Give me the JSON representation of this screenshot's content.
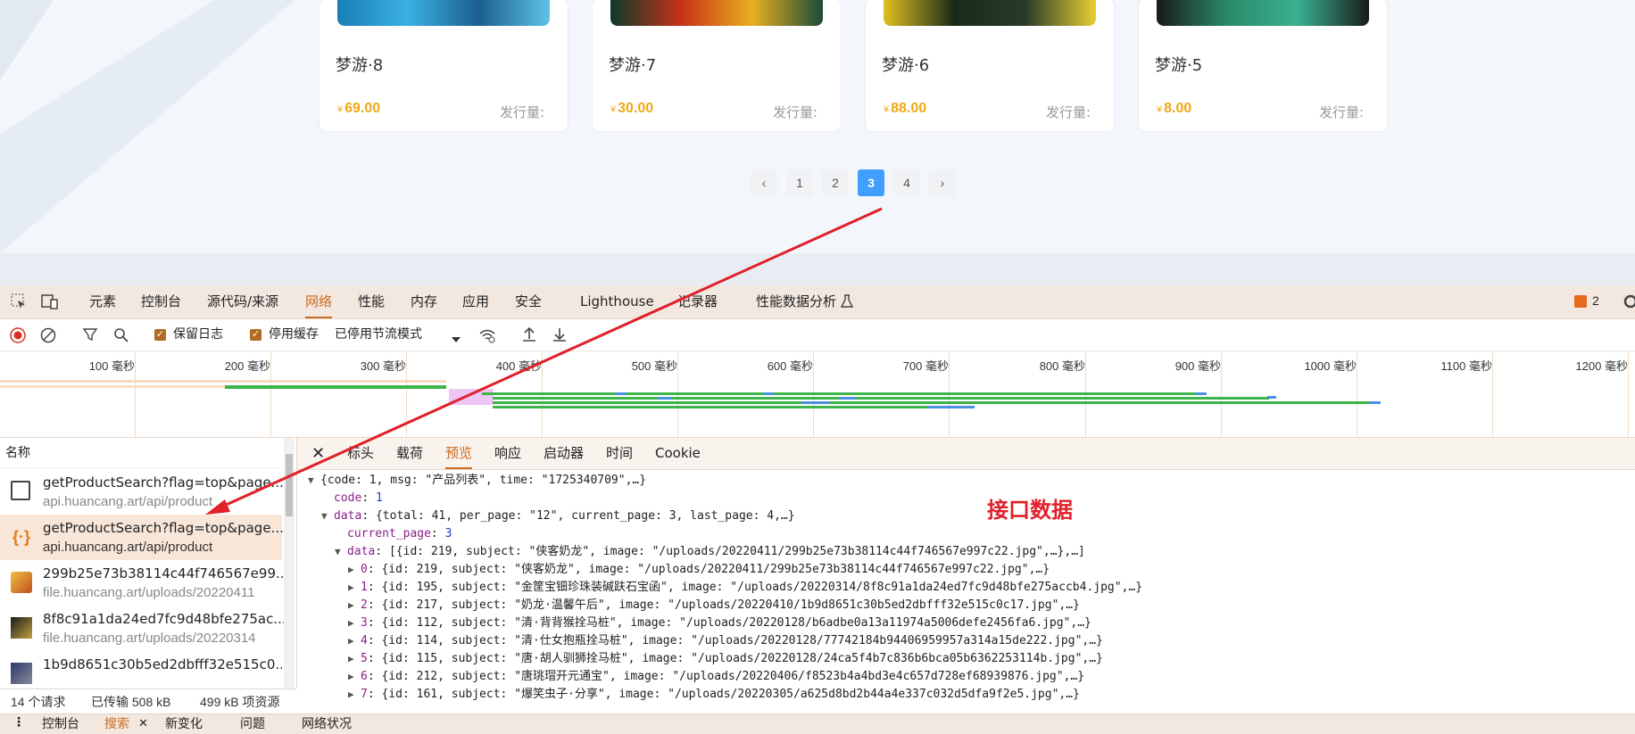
{
  "cards": [
    {
      "title": "梦游·8",
      "currency": "¥",
      "price": "69.00",
      "issue_label": "发行量:"
    },
    {
      "title": "梦游·7",
      "currency": "¥",
      "price": "30.00",
      "issue_label": "发行量:"
    },
    {
      "title": "梦游·6",
      "currency": "¥",
      "price": "88.00",
      "issue_label": "发行量:"
    },
    {
      "title": "梦游·5",
      "currency": "¥",
      "price": "8.00",
      "issue_label": "发行量:"
    }
  ],
  "pagination": {
    "prev": "‹",
    "pages": [
      "1",
      "2",
      "3",
      "4"
    ],
    "current": "3",
    "next": "›"
  },
  "devtools": {
    "tabs": [
      "元素",
      "控制台",
      "源代码/来源",
      "网络",
      "性能",
      "内存",
      "应用",
      "安全",
      "Lighthouse",
      "记录器",
      "性能数据分析"
    ],
    "active_tab": "网络",
    "issues_count": "2",
    "toolbar": {
      "preserve_log": "保留日志",
      "disable_cache": "停用缓存",
      "throttling": "已停用节流模式"
    },
    "timeline_ticks": [
      "100 毫秒",
      "200 毫秒",
      "300 毫秒",
      "400 毫秒",
      "500 毫秒",
      "600 毫秒",
      "700 毫秒",
      "800 毫秒",
      "900 毫秒",
      "1000 毫秒",
      "1100 毫秒",
      "1200 毫秒"
    ],
    "list": {
      "header": "名称",
      "rows": [
        {
          "name": "getProductSearch?flag=top&page...",
          "sub": "api.huancang.art/api/product",
          "icon": "checkbox-icon"
        },
        {
          "name": "getProductSearch?flag=top&page...",
          "sub": "api.huancang.art/api/product",
          "icon": "json-icon"
        },
        {
          "name": "299b25e73b38114c44f746567e99...",
          "sub": "file.huancang.art/uploads/20220411",
          "icon": "image-icon"
        },
        {
          "name": "8f8c91a1da24ed7fc9d48bfe275ac...",
          "sub": "file.huancang.art/uploads/20220314",
          "icon": "image-icon"
        },
        {
          "name": "1b9d8651c30b5ed2dbfff32e515c0...",
          "sub": "",
          "icon": "image-icon"
        }
      ],
      "status": {
        "requests": "14 个请求",
        "transferred": "已传输 508 kB",
        "resources": "499 kB 项资源"
      }
    },
    "detail_tabs": [
      "标头",
      "载荷",
      "预览",
      "响应",
      "启动器",
      "时间",
      "Cookie"
    ],
    "active_detail_tab": "预览",
    "preview": [
      {
        "indent": 0,
        "tri": "▼",
        "text": "{code: 1, msg: \"产品列表\", time: \"1725340709\",…}"
      },
      {
        "indent": 1,
        "tri": "",
        "key": "code",
        "val": "1",
        "type": "num"
      },
      {
        "indent": 1,
        "tri": "▼",
        "key": "data",
        "val": "{total: 41, per_page: \"12\", current_page: 3, last_page: 4,…}",
        "type": "plain"
      },
      {
        "indent": 2,
        "tri": "",
        "key": "current_page",
        "val": "3",
        "type": "num"
      },
      {
        "indent": 2,
        "tri": "▼",
        "key": "data",
        "val": "[{id: 219, subject: \"侠客奶龙\", image: \"/uploads/20220411/299b25e73b38114c44f746567e997c22.jpg\",…},…]",
        "type": "plain"
      },
      {
        "indent": 3,
        "tri": "▶",
        "key": "0",
        "val": "{id: 219, subject: \"侠客奶龙\", image: \"/uploads/20220411/299b25e73b38114c44f746567e997c22.jpg\",…}",
        "type": "plain"
      },
      {
        "indent": 3,
        "tri": "▶",
        "key": "1",
        "val": "{id: 195, subject: \"金筐宝钿珍珠装碱趺石宝函\", image: \"/uploads/20220314/8f8c91a1da24ed7fc9d48bfe275accb4.jpg\",…}",
        "type": "plain"
      },
      {
        "indent": 3,
        "tri": "▶",
        "key": "2",
        "val": "{id: 217, subject: \"奶龙·温馨午后\", image: \"/uploads/20220410/1b9d8651c30b5ed2dbfff32e515c0c17.jpg\",…}",
        "type": "plain"
      },
      {
        "indent": 3,
        "tri": "▶",
        "key": "3",
        "val": "{id: 112, subject: \"清·背背猴拴马桩\", image: \"/uploads/20220128/b6adbe0a13a11974a5006defe2456fa6.jpg\",…}",
        "type": "plain"
      },
      {
        "indent": 3,
        "tri": "▶",
        "key": "4",
        "val": "{id: 114, subject: \"清·仕女抱瓶拴马桩\", image: \"/uploads/20220128/77742184b94406959957a314a15de222.jpg\",…}",
        "type": "plain"
      },
      {
        "indent": 3,
        "tri": "▶",
        "key": "5",
        "val": "{id: 115, subject: \"唐·胡人驯狮拴马桩\", image: \"/uploads/20220128/24ca5f4b7c836b6bca05b6362253114b.jpg\",…}",
        "type": "plain"
      },
      {
        "indent": 3,
        "tri": "▶",
        "key": "6",
        "val": "{id: 212, subject: \"唐珧瑁开元通宝\", image: \"/uploads/20220406/f8523b4a4bd3e4c657d728ef68939876.jpg\",…}",
        "type": "plain"
      },
      {
        "indent": 3,
        "tri": "▶",
        "key": "7",
        "val": "{id: 161, subject: \"爆笑虫子·分享\", image: \"/uploads/20220305/a625d8bd2b44a4e337c032d5dfa9f2e5.jpg\",…}",
        "type": "plain"
      }
    ],
    "drawer": {
      "console": "控制台",
      "search": "搜索",
      "changes": "新变化",
      "issues": "问题",
      "network_conditions": "网络状况"
    }
  },
  "annotation": "接口数据",
  "colors": {
    "accent": "#409eff",
    "price": "#f0a812",
    "devtools_active": "#cc6a1c",
    "annotation": "#e0202a"
  }
}
